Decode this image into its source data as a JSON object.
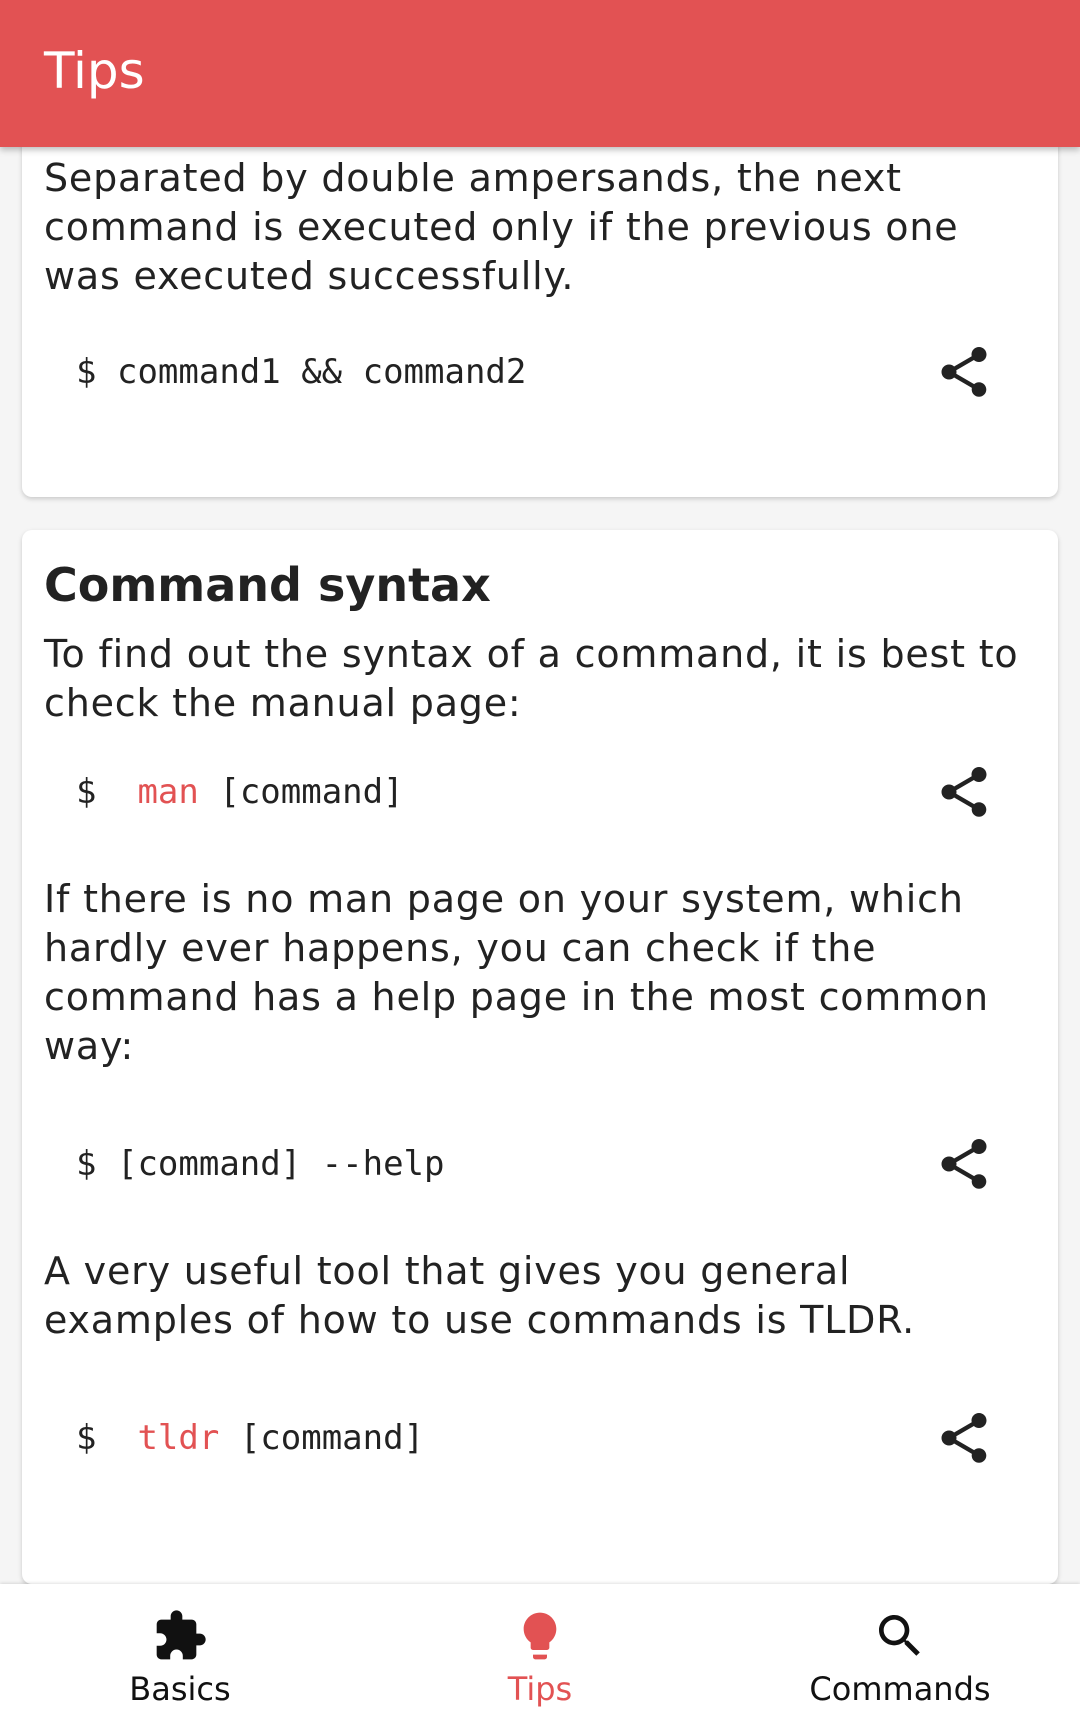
{
  "appbar": {
    "title": "Tips"
  },
  "cards": [
    {
      "paragraph": "Separated by double ampersands, the next command is executed only if the previous one was executed successfully.",
      "command": {
        "prompt": "$",
        "keyword": "",
        "text": "command1 && command2"
      }
    },
    {
      "title": "Command syntax",
      "blocks": [
        {
          "paragraph": "To find out the syntax of a command, it is best to check the manual page:",
          "command": {
            "prompt": "$",
            "keyword": "man",
            "text": "[command]"
          }
        },
        {
          "paragraph": "If there is no man page on your system, which hardly ever happens, you can check if the command has a help page in the most common way:",
          "command": {
            "prompt": "$",
            "keyword": "",
            "text": "[command] --help"
          }
        },
        {
          "paragraph": "A very useful tool that gives you general examples of how to use commands is TLDR.",
          "command": {
            "prompt": "$",
            "keyword": "tldr",
            "text": "[command]"
          }
        }
      ]
    }
  ],
  "bottom_nav": {
    "items": [
      {
        "label": "Basics",
        "icon": "puzzle-icon"
      },
      {
        "label": "Tips",
        "icon": "lightbulb-icon",
        "active": true
      },
      {
        "label": "Commands",
        "icon": "search-icon"
      }
    ]
  },
  "colors": {
    "accent": "#e25253",
    "text": "#222222",
    "background": "#f5f5f5"
  }
}
